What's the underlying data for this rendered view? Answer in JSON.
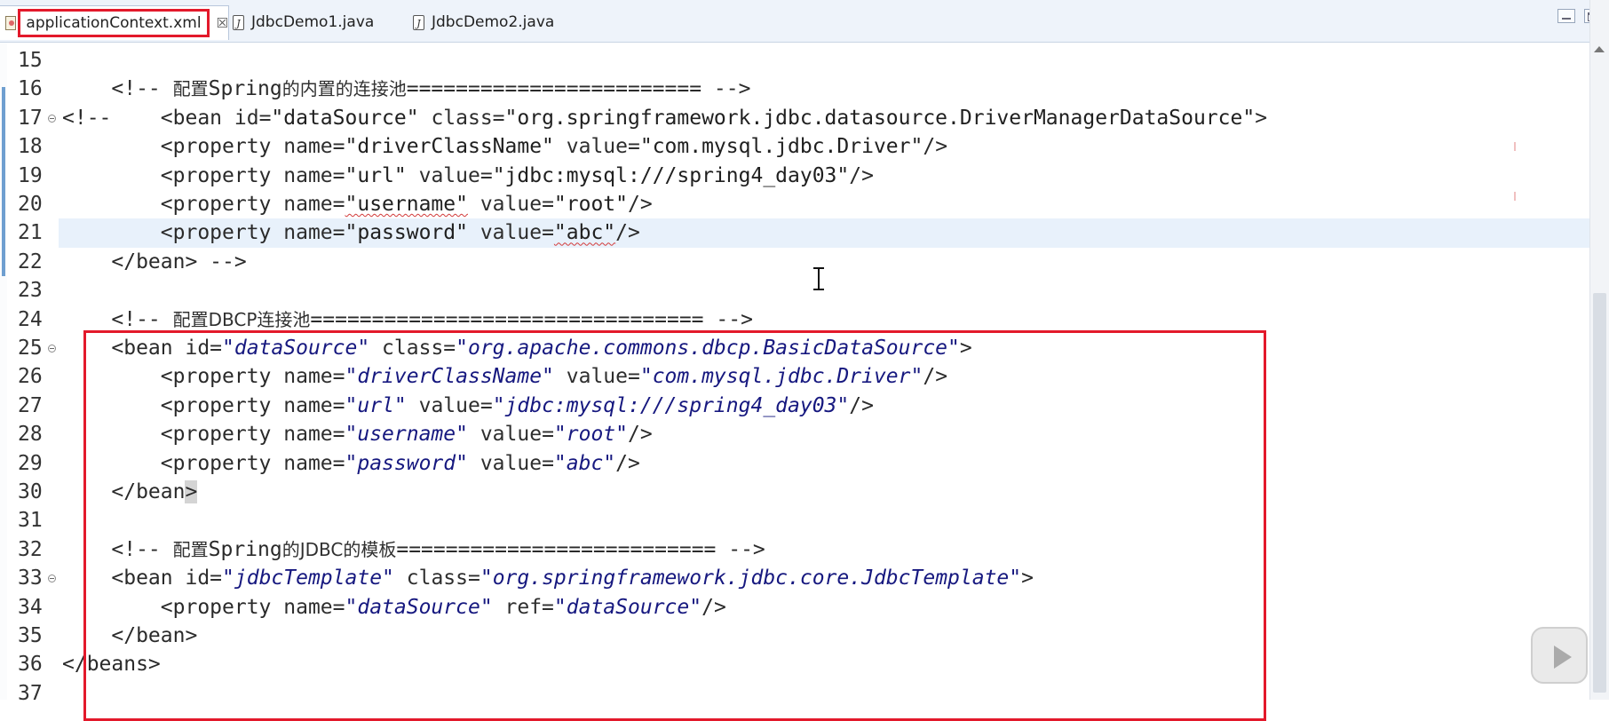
{
  "tabs": [
    {
      "label": "applicationContext.xml",
      "icon": "xml-file-icon",
      "active": true,
      "close": "☒"
    },
    {
      "label": "JdbcDemo1.java",
      "icon": "java-file-icon",
      "active": false
    },
    {
      "label": "JdbcDemo2.java",
      "icon": "java-file-icon",
      "active": false
    }
  ],
  "lines": [
    {
      "n": "15",
      "segs": []
    },
    {
      "n": "16",
      "segs": [
        [
          "    ",
          "t"
        ],
        [
          "<!-- ",
          "t"
        ],
        [
          "配置",
          "cjk"
        ],
        [
          "Spring",
          "t"
        ],
        [
          "的内置的连接池",
          "cjk"
        ],
        [
          "======================== -->",
          "t"
        ]
      ]
    },
    {
      "n": "17",
      "fold": true,
      "segs": [
        [
          "<!--    ",
          "t"
        ],
        [
          "<bean ",
          "t"
        ],
        [
          "id=",
          "a"
        ],
        [
          "\"dataSource\"",
          "v"
        ],
        [
          " class=",
          "a"
        ],
        [
          "\"org.springframework.jdbc.datasource.DriverManagerDataSource\"",
          "v"
        ],
        [
          ">",
          "t"
        ]
      ]
    },
    {
      "n": "18",
      "segs": [
        [
          "        <property ",
          "t"
        ],
        [
          "name=",
          "a"
        ],
        [
          "\"driverClassName\"",
          "v"
        ],
        [
          " value=",
          "a"
        ],
        [
          "\"com.mysql.jdbc.Driver\"",
          "v"
        ],
        [
          "/>",
          "t"
        ]
      ]
    },
    {
      "n": "19",
      "segs": [
        [
          "        <property ",
          "t"
        ],
        [
          "name=",
          "a"
        ],
        [
          "\"url\"",
          "v"
        ],
        [
          " value=",
          "a"
        ],
        [
          "\"jdbc:mysql:///spring4_day03\"",
          "v"
        ],
        [
          "/>",
          "t"
        ]
      ]
    },
    {
      "n": "20",
      "segs": [
        [
          "        <property ",
          "t"
        ],
        [
          "name=",
          "a"
        ],
        [
          "\"username\"",
          "v sq"
        ],
        [
          " value=",
          "a"
        ],
        [
          "\"root\"",
          "v"
        ],
        [
          "/>",
          "t"
        ]
      ]
    },
    {
      "n": "21",
      "current": true,
      "segs": [
        [
          "        <property ",
          "t"
        ],
        [
          "name=",
          "a"
        ],
        [
          "\"password\"",
          "v"
        ],
        [
          " value=",
          "a"
        ],
        [
          "\"abc\"",
          "v sq"
        ],
        [
          "/>",
          "t"
        ]
      ]
    },
    {
      "n": "22",
      "segs": [
        [
          "    </bean> -->",
          "t"
        ]
      ]
    },
    {
      "n": "23",
      "segs": []
    },
    {
      "n": "24",
      "segs": [
        [
          "    <!-- ",
          "t"
        ],
        [
          "配置",
          "cjk"
        ],
        [
          "DBCP",
          "cjk"
        ],
        [
          "连接池",
          "cjk"
        ],
        [
          "================================ -->",
          "t"
        ]
      ]
    },
    {
      "n": "25",
      "fold": true,
      "segs": [
        [
          "    <bean ",
          "t"
        ],
        [
          "id=",
          "a"
        ],
        [
          "\"dataSource\"",
          "iv"
        ],
        [
          " class=",
          "a"
        ],
        [
          "\"org.apache.commons.dbcp.BasicDataSource\"",
          "iv"
        ],
        [
          ">",
          "t"
        ]
      ]
    },
    {
      "n": "26",
      "segs": [
        [
          "        <property ",
          "t"
        ],
        [
          "name=",
          "a"
        ],
        [
          "\"driverClassName\"",
          "iv"
        ],
        [
          " value=",
          "a"
        ],
        [
          "\"com.mysql.jdbc.Driver\"",
          "iv"
        ],
        [
          "/>",
          "t"
        ]
      ]
    },
    {
      "n": "27",
      "segs": [
        [
          "        <property ",
          "t"
        ],
        [
          "name=",
          "a"
        ],
        [
          "\"url\"",
          "iv"
        ],
        [
          " value=",
          "a"
        ],
        [
          "\"jdbc:mysql:///spring4_day03\"",
          "iv"
        ],
        [
          "/>",
          "t"
        ]
      ]
    },
    {
      "n": "28",
      "segs": [
        [
          "        <property ",
          "t"
        ],
        [
          "name=",
          "a"
        ],
        [
          "\"username\"",
          "iv"
        ],
        [
          " value=",
          "a"
        ],
        [
          "\"root\"",
          "iv"
        ],
        [
          "/>",
          "t"
        ]
      ]
    },
    {
      "n": "29",
      "segs": [
        [
          "        <property ",
          "t"
        ],
        [
          "name=",
          "a"
        ],
        [
          "\"password\"",
          "iv"
        ],
        [
          " value=",
          "a"
        ],
        [
          "\"abc\"",
          "iv"
        ],
        [
          "/>",
          "t"
        ]
      ]
    },
    {
      "n": "30",
      "segs": [
        [
          "    </bean",
          "t"
        ],
        [
          ">",
          "t bracketmatch"
        ]
      ]
    },
    {
      "n": "31",
      "segs": []
    },
    {
      "n": "32",
      "segs": [
        [
          "    <!-- ",
          "t"
        ],
        [
          "配置",
          "cjk"
        ],
        [
          "Spring",
          "t"
        ],
        [
          "的",
          "cjk"
        ],
        [
          "JDBC",
          "cjk"
        ],
        [
          "的模板",
          "cjk"
        ],
        [
          "========================== -->",
          "t"
        ]
      ]
    },
    {
      "n": "33",
      "fold": true,
      "segs": [
        [
          "    <bean ",
          "t"
        ],
        [
          "id=",
          "a"
        ],
        [
          "\"jdbcTemplate\"",
          "iv"
        ],
        [
          " class=",
          "a"
        ],
        [
          "\"org.springframework.jdbc.core.JdbcTemplate\"",
          "iv"
        ],
        [
          ">",
          "t"
        ]
      ]
    },
    {
      "n": "34",
      "segs": [
        [
          "        <property ",
          "t"
        ],
        [
          "name=",
          "a"
        ],
        [
          "\"dataSource\"",
          "iv"
        ],
        [
          " ref=",
          "a"
        ],
        [
          "\"dataSource\"",
          "iv"
        ],
        [
          "/>",
          "t"
        ]
      ]
    },
    {
      "n": "35",
      "segs": [
        [
          "    </bean>",
          "t"
        ]
      ]
    },
    {
      "n": "36",
      "segs": [
        [
          "</beans>",
          "t"
        ]
      ]
    },
    {
      "n": "37",
      "segs": []
    }
  ],
  "colors": {
    "highlight_box": "#e3192b",
    "current_line": "#e8f1fb",
    "attr_value_italic": "#16187f"
  }
}
